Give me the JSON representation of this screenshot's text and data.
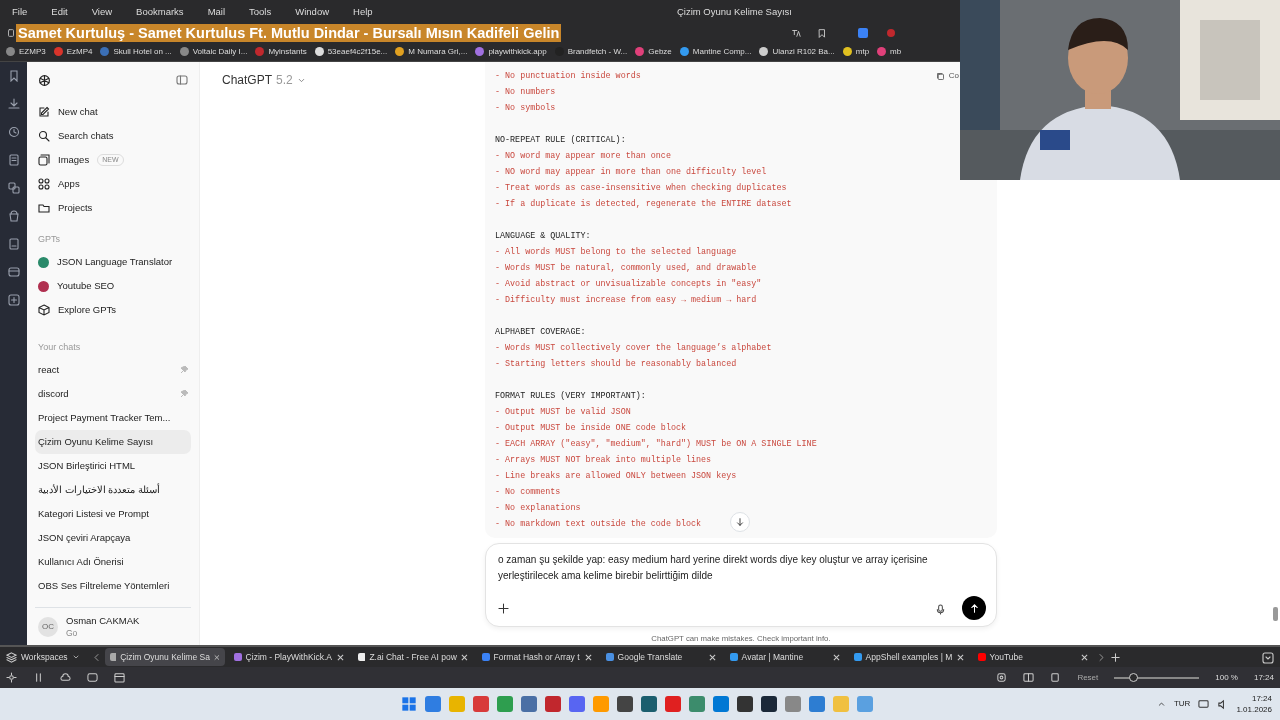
{
  "menu_bar": {
    "items": [
      "File",
      "Edit",
      "View",
      "Bookmarks",
      "Mail",
      "Tools",
      "Window",
      "Help"
    ],
    "title": "Çizim Oyunu Kelime Sayısı"
  },
  "address_bar": {
    "text": "Samet Kurtuluş - Samet Kurtulus Ft. Mutlu Dindar - Bursalı Mısın Kadifeli Gelin"
  },
  "bookmarks": [
    {
      "label": "EZMP3",
      "color": "#888888"
    },
    {
      "label": "EzMP4",
      "color": "#d9342b"
    },
    {
      "label": "Skull Hotel on ...",
      "color": "#3b6fb6"
    },
    {
      "label": "Voltaic Daily I...",
      "color": "#888888"
    },
    {
      "label": "Myinstants",
      "color": "#c0282d"
    },
    {
      "label": "53eaef4c2f15e...",
      "color": "#dddddd"
    },
    {
      "label": "M Numara Gri,...",
      "color": "#e0a020"
    },
    {
      "label": "playwithkick.app",
      "color": "#a070e0"
    },
    {
      "label": "Brandfetch - W...",
      "color": "#222222"
    },
    {
      "label": "Gebze",
      "color": "#e0407a"
    },
    {
      "label": "Mantine Comp...",
      "color": "#339af0"
    },
    {
      "label": "Ulanzi R102 Ba...",
      "color": "#cccccc"
    },
    {
      "label": "mtp",
      "color": "#e0c020"
    },
    {
      "label": "mb",
      "color": "#e0407a"
    }
  ],
  "sidebar": {
    "nav": [
      {
        "kind": "new-chat",
        "label": "New chat"
      },
      {
        "kind": "search",
        "label": "Search chats"
      },
      {
        "kind": "images",
        "label": "Images",
        "badge": "NEW"
      },
      {
        "kind": "apps",
        "label": "Apps"
      },
      {
        "kind": "projects",
        "label": "Projects"
      }
    ],
    "gpts_heading": "GPTs",
    "gpts": [
      {
        "kind": "avatar",
        "label": "JSON Language Translator",
        "color": "#2a8a6a"
      },
      {
        "kind": "avatar",
        "label": "Youtube SEO",
        "color": "#b03050"
      },
      {
        "kind": "explore",
        "label": "Explore GPTs"
      }
    ],
    "chats_heading": "Your chats",
    "chats": [
      {
        "label": "react",
        "pinned": true,
        "selected": false
      },
      {
        "label": "discord",
        "pinned": true,
        "selected": false
      },
      {
        "label": "Project Payment Tracker Tem...",
        "pinned": false,
        "selected": false
      },
      {
        "label": "Çizim Oyunu Kelime Sayısı",
        "pinned": false,
        "selected": true
      },
      {
        "label": "JSON Birleştirici HTML",
        "pinned": false,
        "selected": false
      },
      {
        "label": "أسئلة متعددة الاختيارات الأدبية",
        "pinned": false,
        "selected": false
      },
      {
        "label": "Kategori Listesi ve Prompt",
        "pinned": false,
        "selected": false
      },
      {
        "label": "JSON çeviri Arapçaya",
        "pinned": false,
        "selected": false
      },
      {
        "label": "Kullanıcı Adı Önerisi",
        "pinned": false,
        "selected": false
      },
      {
        "label": "OBS Ses Filtreleme Yöntemleri",
        "pinned": false,
        "selected": false
      }
    ],
    "user": {
      "initials": "OC",
      "name": "Osman CAKMAK",
      "plan": "Go"
    }
  },
  "header": {
    "title": "ChatGPT",
    "version": "5.2"
  },
  "code_block": {
    "copy_label": "Co",
    "sections": [
      {
        "items": [
          "- No punctuation inside words",
          "- No numbers",
          "- No symbols"
        ]
      },
      {
        "heading": "NO-REPEAT RULE (CRITICAL):",
        "items": [
          "- NO word may appear more than once",
          "- NO word may appear in more than one difficulty level",
          "- Treat words as case-insensitive when checking duplicates",
          "- If a duplicate is detected, regenerate the ENTIRE dataset"
        ]
      },
      {
        "heading": "LANGUAGE & QUALITY:",
        "items": [
          "- All words MUST belong to the selected language",
          "- Words MUST be natural, commonly used, and drawable",
          "- Avoid abstract or unvisualizable concepts in \"easy\"",
          "- Difficulty must increase from easy → medium → hard"
        ]
      },
      {
        "heading": "ALPHABET COVERAGE:",
        "items": [
          "- Words MUST collectively cover the language’s alphabet",
          "- Starting letters should be reasonably balanced"
        ]
      },
      {
        "heading": "FORMAT RULES (VERY IMPORTANT):",
        "items": [
          "- Output MUST be valid JSON",
          "- Output MUST be inside ONE code block",
          "- EACH ARRAY (\"easy\", \"medium\", \"hard\") MUST be ON A SINGLE LINE",
          "- Arrays MUST NOT break into multiple lines",
          "- Line breaks are allowed ONLY between JSON keys",
          "- No comments",
          "- No explanations",
          "- No markdown text outside the code block"
        ]
      }
    ]
  },
  "composer": {
    "value": "o zaman şu şekilde yap: easy medium hard yerine direkt words diye key oluştur ve array içerisine yerleştirilecek ama kelime birebir belirttiğim dilde"
  },
  "disclaimer": "ChatGPT can make mistakes. Check important info.",
  "tab_bar": {
    "workspaces": "Workspaces",
    "tabs": [
      {
        "label": "Çizim Oyunu Kelime Sa",
        "color": "#aaaaaa",
        "selected": true
      },
      {
        "label": "Çizim - PlayWithKick.A",
        "color": "#a070e0",
        "selected": false
      },
      {
        "label": "Z.ai Chat - Free AI pow",
        "color": "#eeeeee",
        "selected": false
      },
      {
        "label": "Format Hash or Array t",
        "color": "#3b82f6",
        "selected": false
      },
      {
        "label": "Google Translate",
        "color": "#4a90e2",
        "selected": false
      },
      {
        "label": "Avatar | Mantine",
        "color": "#339af0",
        "selected": false
      },
      {
        "label": "AppShell examples | M",
        "color": "#339af0",
        "selected": false
      },
      {
        "label": "YouTube",
        "color": "#ff0000",
        "selected": false
      }
    ]
  },
  "status_bar": {
    "reset": "Reset",
    "zoom": {
      "level": 0.22
    },
    "zoom_text": "100 %",
    "clock": "17:24"
  },
  "taskbar": {
    "apps": [
      {
        "color": "#2f7de1"
      },
      {
        "color": "#e8b400"
      },
      {
        "color": "#d83a3a"
      },
      {
        "color": "#2e9e4f"
      },
      {
        "color": "#4a6fa5"
      },
      {
        "color": "#c1272d"
      },
      {
        "color": "#5865f2"
      },
      {
        "color": "#ff9a00"
      },
      {
        "color": "#444444"
      },
      {
        "color": "#1b5e6e"
      },
      {
        "color": "#e02020"
      },
      {
        "color": "#3c8c6c"
      },
      {
        "color": "#0078d4"
      },
      {
        "color": "#333333"
      },
      {
        "color": "#1b2838"
      },
      {
        "color": "#888888"
      },
      {
        "color": "#2d7dd2"
      },
      {
        "color": "#f0c040"
      },
      {
        "color": "#5aa0e0"
      }
    ],
    "lang": "TUR",
    "time": "17:24",
    "date": "1.01.2026"
  }
}
